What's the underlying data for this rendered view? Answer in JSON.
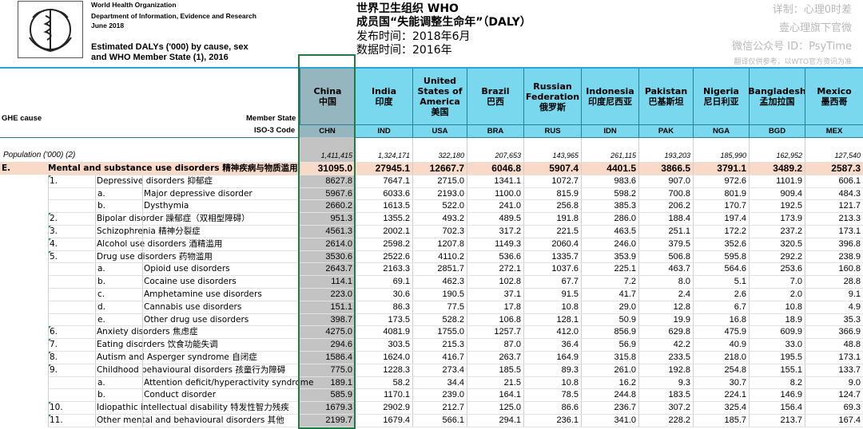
{
  "header": {
    "org": "World Health Organization",
    "dept": "Department of Information, Evidence and Research",
    "date": "June 2018",
    "title1": "Estimated DALYs ('000) by cause, sex",
    "title2": "and WHO Member State (1), 2016",
    "cn1": "世界卫生组织 WHO",
    "cn2": "成员国“失能调整生命年”（DALY）",
    "cn3": "发布时间：2018年6月",
    "cn4": "数据时间：2016年"
  },
  "watermark": {
    "line1": "详制：心理0时差",
    "line2": "壹心理旗下官微",
    "line3": "微信公众号 ID：PsyTime",
    "line4": "翻译仅供参考，以WTO官方资讯为准"
  },
  "grid_labels": {
    "ghe_cause": "GHE cause",
    "member_state": "Member State",
    "iso_code": "ISO-3 Code",
    "population": "Population ('000) (2)"
  },
  "countries": [
    {
      "name": "China\n中国",
      "code": "CHN"
    },
    {
      "name": "India\n印度",
      "code": "IND"
    },
    {
      "name": "United\nStates of\nAmerica\n美国",
      "code": "USA"
    },
    {
      "name": "Brazil\n巴西",
      "code": "BRA"
    },
    {
      "name": "Russian\nFederation\n俄罗斯",
      "code": "RUS"
    },
    {
      "name": "Indonesia\n印度尼西亚",
      "code": "IDN"
    },
    {
      "name": "Pakistan\n巴基斯坦",
      "code": "PAK"
    },
    {
      "name": "Nigeria\n尼日利亚",
      "code": "NGA"
    },
    {
      "name": "Bangladesh\n孟加拉国",
      "code": "BGD"
    },
    {
      "name": "Mexico\n墨西哥",
      "code": "MEX"
    }
  ],
  "population": [
    "1,411,415",
    "1,324,171",
    "322,180",
    "207,653",
    "143,965",
    "261,115",
    "193,203",
    "185,990",
    "162,952",
    "127,540"
  ],
  "rows": [
    {
      "code": "E.",
      "num": "",
      "sub": "",
      "label": "Mental and substance use disorders 精神疾病与物质滥用",
      "level": 0,
      "values": [
        "31095.0",
        "27945.1",
        "12667.7",
        "6046.8",
        "5907.4",
        "4401.5",
        "3866.5",
        "3791.1",
        "3489.2",
        "2587.3"
      ]
    },
    {
      "code": "",
      "num": "1.",
      "sub": "",
      "label": "Depressive disorders 抑郁症",
      "level": 1,
      "values": [
        "8627.8",
        "7647.1",
        "2715.0",
        "1341.1",
        "1072.7",
        "983.6",
        "907.0",
        "972.6",
        "1101.9",
        "606.1"
      ]
    },
    {
      "code": "",
      "num": "",
      "sub": "a.",
      "label": "Major depressive disorder",
      "level": 2,
      "values": [
        "5967.6",
        "6033.6",
        "2193.0",
        "1100.0",
        "815.9",
        "598.2",
        "700.8",
        "801.9",
        "909.4",
        "484.3"
      ]
    },
    {
      "code": "",
      "num": "",
      "sub": "b.",
      "label": "Dysthymia",
      "level": 2,
      "values": [
        "2660.2",
        "1613.5",
        "522.0",
        "241.0",
        "256.8",
        "385.3",
        "206.2",
        "170.7",
        "192.5",
        "121.7"
      ]
    },
    {
      "code": "",
      "num": "2.",
      "sub": "",
      "label": "Bipolar disorder 躁郁症（双相型障碍）",
      "level": 1,
      "values": [
        "951.3",
        "1355.2",
        "493.2",
        "489.5",
        "191.8",
        "286.0",
        "188.4",
        "197.4",
        "173.9",
        "213.3"
      ]
    },
    {
      "code": "",
      "num": "3.",
      "sub": "",
      "label": "Schizophrenia 精神分裂症",
      "level": 1,
      "values": [
        "4561.3",
        "2002.1",
        "702.3",
        "317.2",
        "221.5",
        "463.5",
        "251.1",
        "172.2",
        "237.2",
        "173.1"
      ]
    },
    {
      "code": "",
      "num": "4.",
      "sub": "",
      "label": "Alcohol use disorders 酒精滥用",
      "level": 1,
      "values": [
        "2614.0",
        "2598.2",
        "1207.8",
        "1149.3",
        "2060.4",
        "246.0",
        "379.5",
        "352.6",
        "320.5",
        "396.8"
      ]
    },
    {
      "code": "",
      "num": "5.",
      "sub": "",
      "label": "Drug use disorders 药物滥用",
      "level": 1,
      "values": [
        "3530.6",
        "2522.6",
        "4110.2",
        "536.6",
        "1335.7",
        "353.9",
        "506.8",
        "595.8",
        "292.2",
        "238.9"
      ]
    },
    {
      "code": "",
      "num": "",
      "sub": "a.",
      "label": "Opioid use disorders",
      "level": 2,
      "values": [
        "2643.7",
        "2163.3",
        "2851.7",
        "272.1",
        "1037.6",
        "225.1",
        "463.7",
        "564.6",
        "253.6",
        "160.8"
      ]
    },
    {
      "code": "",
      "num": "",
      "sub": "b.",
      "label": "Cocaine use disorders",
      "level": 2,
      "values": [
        "114.1",
        "69.1",
        "462.3",
        "102.8",
        "67.7",
        "7.2",
        "8.0",
        "5.1",
        "7.0",
        "28.8"
      ]
    },
    {
      "code": "",
      "num": "",
      "sub": "c.",
      "label": "Amphetamine use disorders",
      "level": 2,
      "values": [
        "223.0",
        "30.6",
        "190.5",
        "37.1",
        "91.5",
        "41.7",
        "2.4",
        "2.6",
        "2.0",
        "9.1"
      ]
    },
    {
      "code": "",
      "num": "",
      "sub": "d.",
      "label": "Cannabis use disorders",
      "level": 2,
      "values": [
        "151.1",
        "86.3",
        "77.5",
        "17.8",
        "10.8",
        "29.0",
        "12.8",
        "6.7",
        "10.8",
        "4.9"
      ]
    },
    {
      "code": "",
      "num": "",
      "sub": "e.",
      "label": "Other drug use disorders",
      "level": 2,
      "values": [
        "398.7",
        "173.5",
        "528.2",
        "106.8",
        "128.1",
        "50.9",
        "19.9",
        "16.8",
        "18.9",
        "35.3"
      ]
    },
    {
      "code": "",
      "num": "6.",
      "sub": "",
      "label": "Anxiety disorders 焦虑症",
      "level": 1,
      "values": [
        "4275.0",
        "4081.9",
        "1755.0",
        "1257.7",
        "412.0",
        "856.9",
        "629.8",
        "475.9",
        "609.9",
        "366.9"
      ]
    },
    {
      "code": "",
      "num": "7.",
      "sub": "",
      "label": "Eating disorders 饮食功能失调",
      "level": 1,
      "values": [
        "294.6",
        "303.5",
        "215.3",
        "87.0",
        "36.4",
        "56.9",
        "42.2",
        "40.9",
        "33.0",
        "48.8"
      ]
    },
    {
      "code": "",
      "num": "8.",
      "sub": "",
      "label": "Autism and Asperger syndrome 自闭症",
      "level": 1,
      "values": [
        "1586.4",
        "1624.0",
        "416.7",
        "263.7",
        "164.9",
        "315.8",
        "233.5",
        "218.0",
        "195.5",
        "173.1"
      ]
    },
    {
      "code": "",
      "num": "9.",
      "sub": "",
      "label": "Childhood behavioural disorders 孩童行为障碍",
      "level": 1,
      "values": [
        "775.0",
        "1228.3",
        "273.4",
        "185.5",
        "89.3",
        "261.0",
        "192.8",
        "254.8",
        "155.1",
        "133.7"
      ]
    },
    {
      "code": "",
      "num": "",
      "sub": "a.",
      "label": "Attention deficit/hyperactivity syndrome",
      "level": 2,
      "values": [
        "189.1",
        "58.2",
        "34.4",
        "21.5",
        "10.8",
        "16.2",
        "9.3",
        "30.7",
        "8.2",
        "9.0"
      ]
    },
    {
      "code": "",
      "num": "",
      "sub": "b.",
      "label": "Conduct disorder",
      "level": 2,
      "values": [
        "585.9",
        "1170.1",
        "239.0",
        "164.1",
        "78.5",
        "244.8",
        "183.5",
        "224.1",
        "146.9",
        "124.7"
      ]
    },
    {
      "code": "",
      "num": "10.",
      "sub": "",
      "label": "Idiopathic intellectual disability 特发性智力残疾",
      "level": 1,
      "values": [
        "1679.3",
        "2902.9",
        "212.7",
        "125.0",
        "86.6",
        "236.7",
        "307.2",
        "325.4",
        "156.4",
        "69.3"
      ]
    },
    {
      "code": "",
      "num": "11.",
      "sub": "",
      "label": "Other mental and behavioural disorders 其他",
      "level": 1,
      "values": [
        "2199.7",
        "1679.4",
        "566.1",
        "294.1",
        "236.1",
        "341.0",
        "228.2",
        "185.7",
        "213.7",
        "167.4"
      ]
    }
  ],
  "colors": {
    "header_cyan": "#79d8ee",
    "header_band_blue": "#2aa3d6",
    "china_column_gray": "#c3c3c3",
    "highlight_row": "#f9d9c8",
    "selection_green": "#1f7a43"
  }
}
